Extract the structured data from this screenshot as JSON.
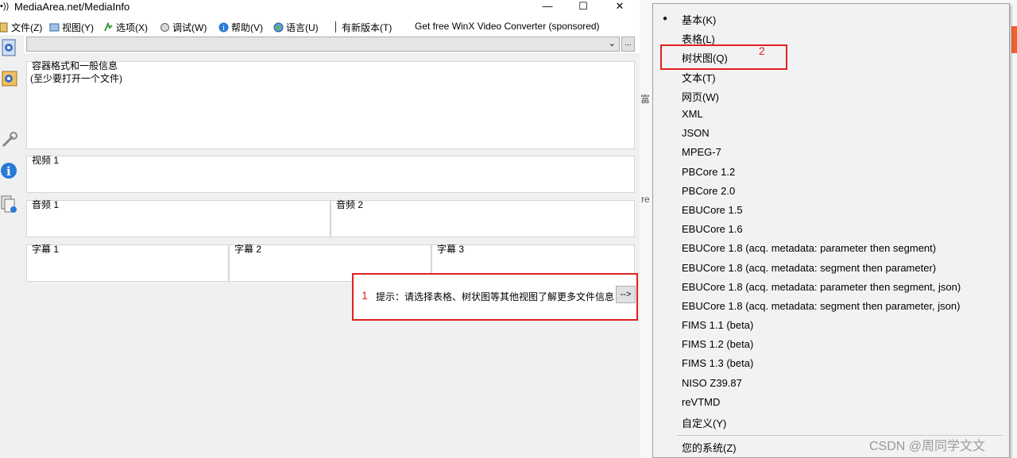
{
  "window": {
    "title": "MediaArea.net/MediaInfo",
    "title_icon": "•))",
    "minimize": "—",
    "maximize": "☐",
    "close": "✕"
  },
  "menubar": {
    "items": [
      {
        "label": "文件(Z)",
        "icon": "file-icon"
      },
      {
        "label": "视图(Y)",
        "icon": "view-icon"
      },
      {
        "label": "选项(X)",
        "icon": "options-icon"
      },
      {
        "label": "调试(W)",
        "icon": "debug-icon"
      },
      {
        "label": "帮助(V)",
        "icon": "help-icon"
      },
      {
        "label": "语言(U)",
        "icon": "language-icon"
      }
    ],
    "new_version": "有新版本(T)",
    "sponsored": "Get free WinX Video Converter (sponsored)"
  },
  "file_select": {
    "value": "",
    "chevron": "⌄"
  },
  "browse_label": "...",
  "panels": {
    "general_title": "容器格式和一般信息",
    "general_text": "(至少要打开一个文件)",
    "video1": "视频 1",
    "audio1": "音频 1",
    "audio2": "音频 2",
    "sub1": "字幕 1",
    "sub2": "字幕 2",
    "sub3": "字幕 3"
  },
  "hint": {
    "number": "1",
    "text": "提示：请选择表格、树状图等其他视图了解更多文件信息",
    "button": "-->"
  },
  "bg_fragments": {
    "a": "富",
    "b": "re"
  },
  "context_menu": {
    "bullet": "●",
    "items": [
      "基本(K)",
      "表格(L)",
      "树状图(Q)",
      "文本(T)",
      "网页(W)",
      "XML",
      "JSON",
      "MPEG-7",
      "PBCore 1.2",
      "PBCore 2.0",
      "EBUCore 1.5",
      "EBUCore 1.6",
      "EBUCore 1.8 (acq. metadata: parameter then segment)",
      "EBUCore 1.8 (acq. metadata: segment then parameter)",
      "EBUCore 1.8 (acq. metadata: parameter then segment, json)",
      "EBUCore 1.8 (acq. metadata: segment then parameter, json)",
      "FIMS 1.1 (beta)",
      "FIMS 1.2 (beta)",
      "FIMS 1.3 (beta)",
      "NISO Z39.87",
      "reVTMD",
      "自定义(Y)"
    ],
    "footer_item": "您的系统(Z)",
    "highlight_number": "2"
  },
  "watermark": "CSDN @周同学文文",
  "colors": {
    "annotation_red": "#e02020",
    "orange_accent": "#f0622d"
  }
}
